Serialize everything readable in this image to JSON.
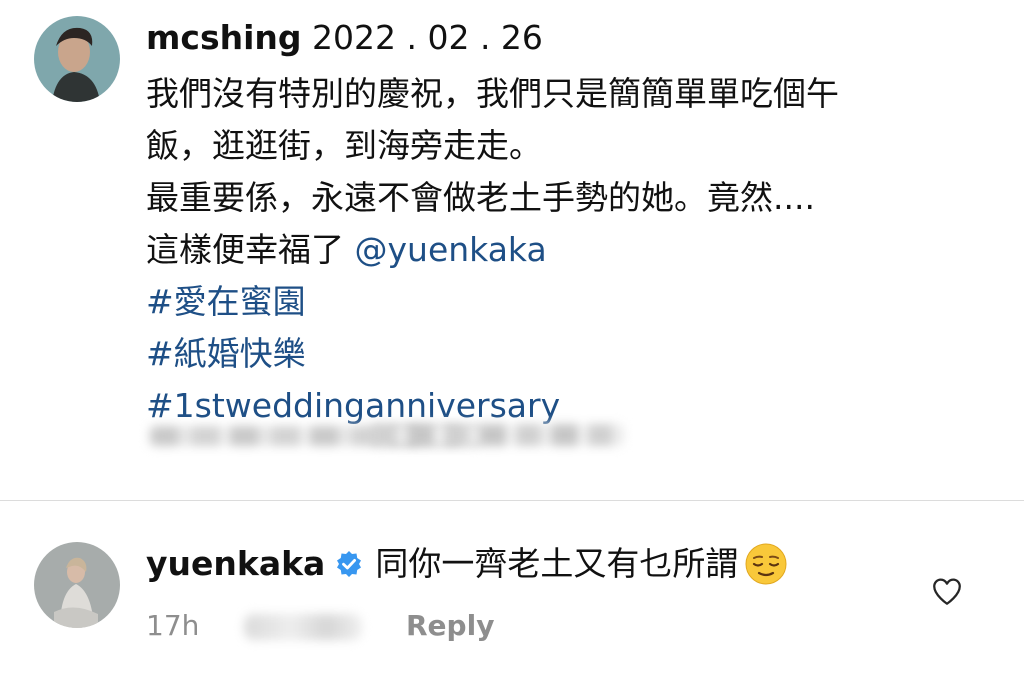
{
  "post": {
    "username": "mcshing",
    "date": "2022 . 02 . 26",
    "lines": [
      "我們沒有特別的慶祝，我們只是簡簡單單吃個午",
      "飯，逛逛街，到海旁走走。",
      "最重要係，永遠不會做老土手勢的她。竟然....",
      "這樣便幸福了"
    ],
    "mention": "@yuenkaka",
    "hashtags": [
      "#愛在蜜園",
      "#紙婚快樂",
      "#1stweddinganniversary"
    ]
  },
  "comment": {
    "username": "yuenkaka",
    "verified_icon": "verified-badge-icon",
    "text": "同你一齊老土又有乜所謂",
    "emoji": "relieved-face",
    "time": "17h",
    "reply_label": "Reply",
    "like_icon": "heart-outline-icon"
  },
  "colors": {
    "link": "#1e4f86",
    "verified": "#3897f0",
    "meta": "#8e8e8e",
    "divider": "#dcdcdc"
  }
}
